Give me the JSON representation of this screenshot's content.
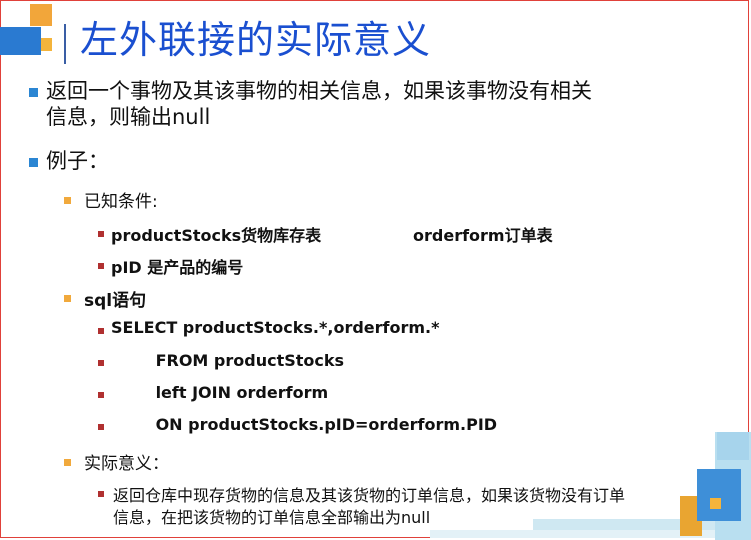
{
  "slide": {
    "title": "左外联接的实际意义",
    "bullet1_line1": "返回一个事物及其该事物的相关信息，如果该事物没有相关",
    "bullet1_line2": "信息，则输出null",
    "bullet2": "例子：",
    "sub1": "已知条件:",
    "sub1_item1_a": "productStocks货物库存表",
    "sub1_item1_b": "orderform订单表",
    "sub1_item2": "pID 是产品的编号",
    "sub2": "sql语句",
    "sql_lines": [
      "SELECT productStocks.*,orderform.*",
      "        FROM productStocks",
      "        left JOIN orderform",
      "        ON productStocks.pID=orderform.PID"
    ],
    "sub3": "实际意义：",
    "sub3_item_line1": "返回仓库中现存货物的信息及其该货物的订单信息，如果该货物没有订单",
    "sub3_item_line2": "信息，在把该货物的订单信息全部输出为null"
  },
  "colors": {
    "title": "#1a4fd0",
    "level1_bullet": "#2b86d3",
    "level2_bullet": "#f1a93c",
    "level3_bullet": "#b03030",
    "frame": "#e0413a"
  }
}
